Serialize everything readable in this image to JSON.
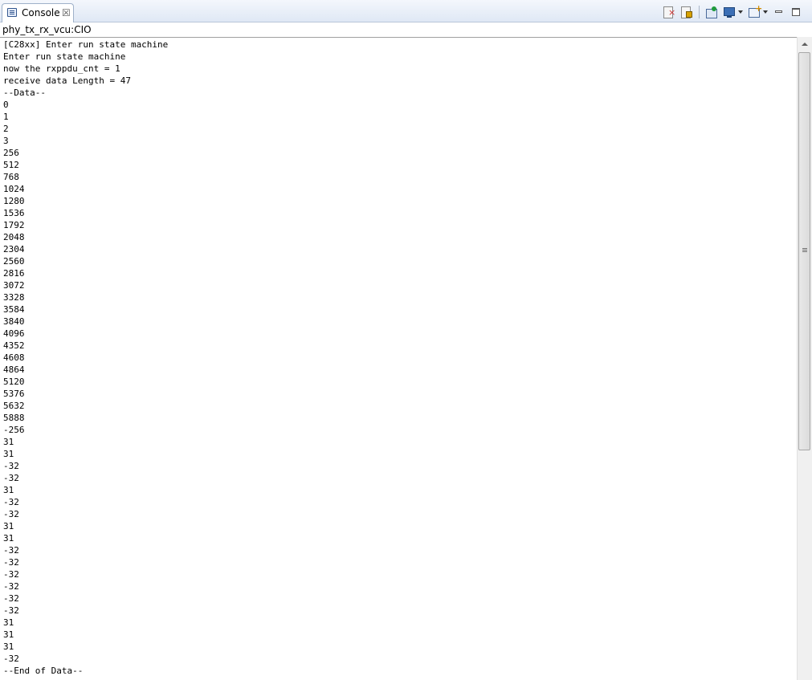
{
  "tab": {
    "label": "Console",
    "close_glyph": "☒"
  },
  "toolbar": {
    "buttons": [
      {
        "name": "clear-console",
        "icon": "clear-console-icon"
      },
      {
        "name": "scroll-lock",
        "icon": "scroll-lock-icon"
      },
      {
        "name": "pin-console",
        "icon": "pin-console-icon"
      },
      {
        "name": "display-selected-console",
        "icon": "display-console-icon"
      },
      {
        "name": "open-console",
        "icon": "new-console-icon"
      },
      {
        "name": "minimize",
        "icon": "minimize-icon"
      },
      {
        "name": "maximize",
        "icon": "maximize-icon"
      }
    ]
  },
  "process": {
    "label": "phy_tx_rx_vcu:CIO"
  },
  "console": {
    "lines": [
      "[C28xx] Enter run state machine",
      "Enter run state machine",
      "now the rxppdu_cnt = 1",
      "receive data Length = 47",
      "--Data--",
      "0",
      "1",
      "2",
      "3",
      "256",
      "512",
      "768",
      "1024",
      "1280",
      "1536",
      "1792",
      "2048",
      "2304",
      "2560",
      "2816",
      "3072",
      "3328",
      "3584",
      "3840",
      "4096",
      "4352",
      "4608",
      "4864",
      "5120",
      "5376",
      "5632",
      "5888",
      "-256",
      "31",
      "31",
      "-32",
      "-32",
      "31",
      "-32",
      "-32",
      "31",
      "31",
      "-32",
      "-32",
      "-32",
      "-32",
      "-32",
      "-32",
      "31",
      "31",
      "31",
      "-32",
      "--End of Data--"
    ]
  }
}
